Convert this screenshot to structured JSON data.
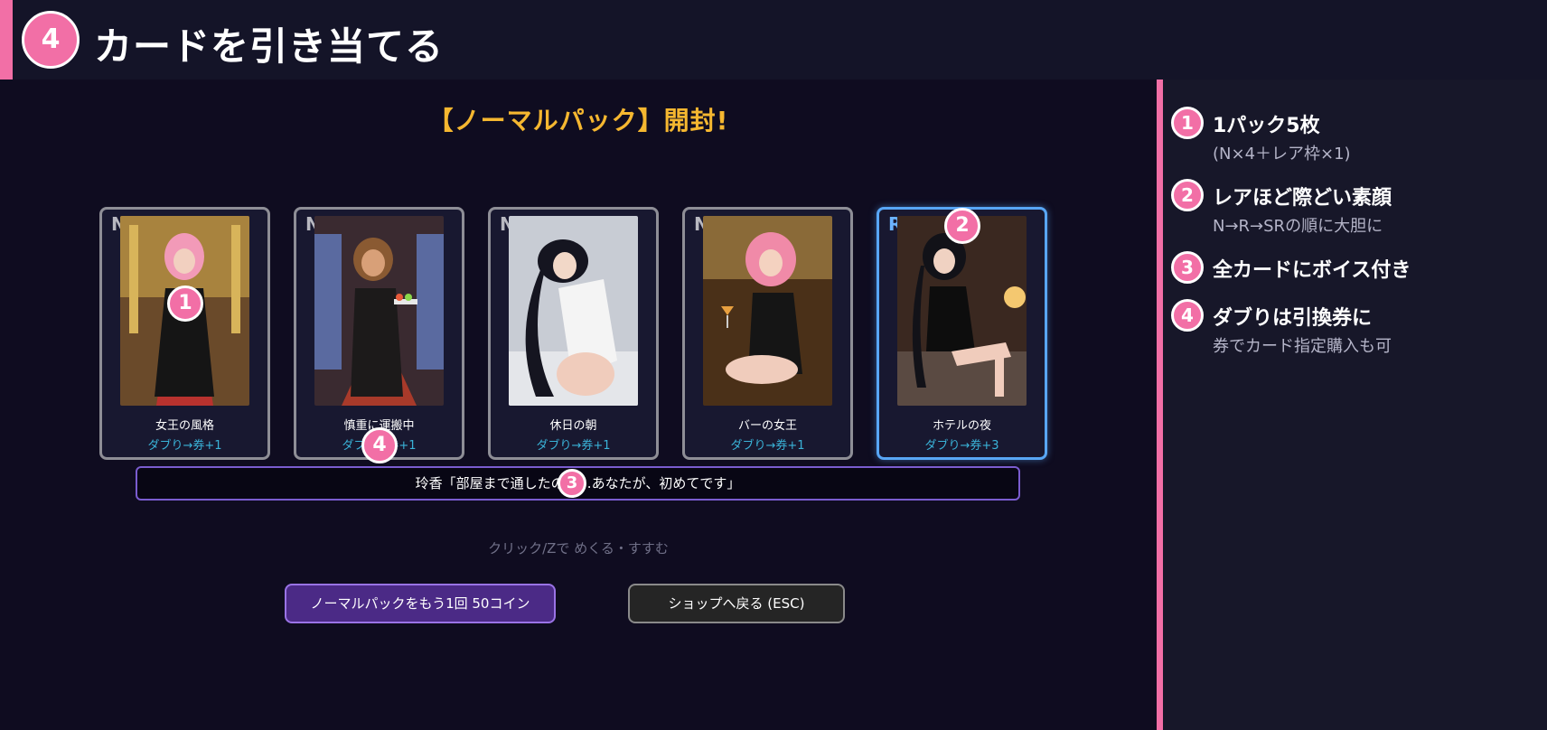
{
  "header": {
    "step_number": "4",
    "title": "カードを引き当てる"
  },
  "game": {
    "pack_title": "【ノーマルパック】開封!",
    "cards": [
      {
        "rarity": "N",
        "name": "女王の風格",
        "duplicate": "ダブり→券+1"
      },
      {
        "rarity": "N",
        "name": "慎重に運搬中",
        "duplicate": "ダブり→券+1"
      },
      {
        "rarity": "N",
        "name": "休日の朝",
        "duplicate": "ダブり→券+1"
      },
      {
        "rarity": "N",
        "name": "バーの女王",
        "duplicate": "ダブり→券+1"
      },
      {
        "rarity": "R",
        "name": "ホテルの夜",
        "duplicate": "ダブり→券+3"
      }
    ],
    "dialogue": "玲香「部屋まで通したのは…あなたが、初めてです」",
    "hint": "クリック/Zで めくる・すすむ",
    "buttons": {
      "again": "ノーマルパックをもう1回 50コイン",
      "shop": "ショップへ戻る (ESC)"
    }
  },
  "markers": [
    "1",
    "2",
    "3",
    "4"
  ],
  "features": [
    {
      "number": "1",
      "title": "1パック5枚",
      "subtitle": "(N×4＋レア枠×1)"
    },
    {
      "number": "2",
      "title": "レアほど際どい素顔",
      "subtitle": "N→R→SRの順に大胆に"
    },
    {
      "number": "3",
      "title": "全カードにボイス付き",
      "subtitle": ""
    },
    {
      "number": "4",
      "title": "ダブりは引換券に",
      "subtitle": "券でカード指定購入も可"
    }
  ],
  "colors": {
    "accent_pink": "#f26fa6",
    "title_gold": "#f5b730",
    "duplicate_cyan": "#3ab3d8",
    "rare_blue": "#58a6f5",
    "dialog_purple": "#7a5ccf"
  }
}
